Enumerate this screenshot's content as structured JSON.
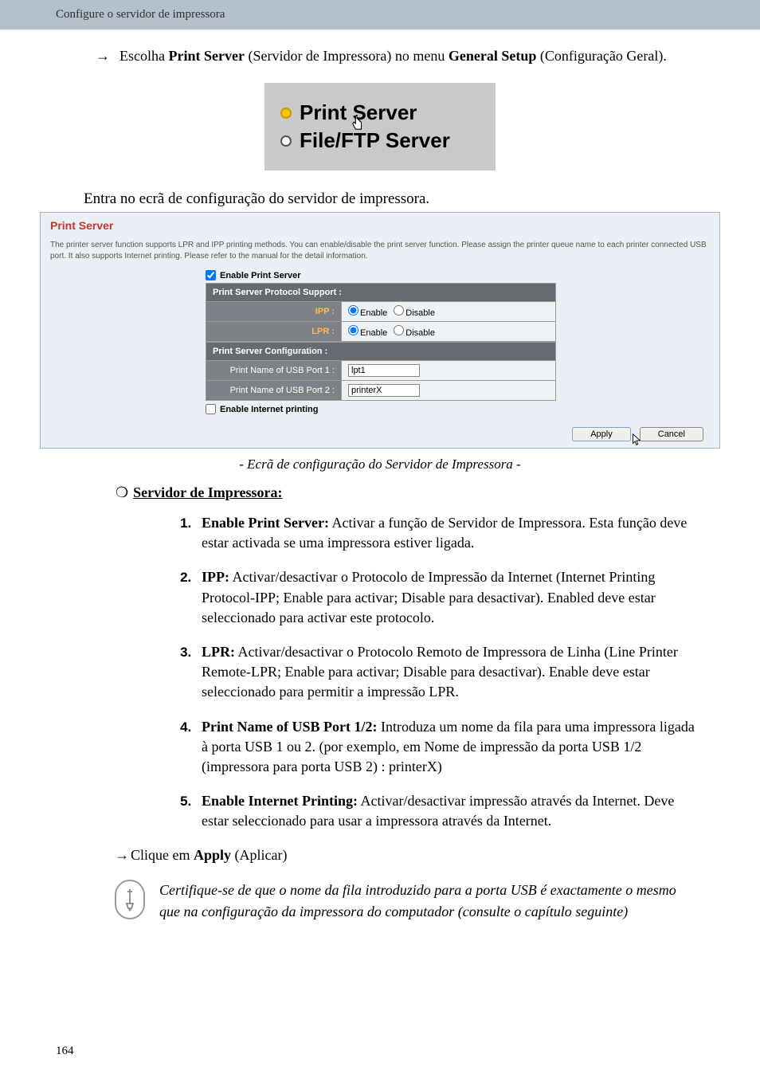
{
  "header": "Configure o servidor de impressora",
  "instruction": {
    "prefix": "Escolha ",
    "b1": "Print Server",
    "mid1": " (Servidor de Impressora) no menu ",
    "b2": "General Setup",
    "suffix": " (Configuração Geral)."
  },
  "menu": {
    "opt1": "Print Server",
    "opt2": "File/FTP Server"
  },
  "lead": "Entra no ecrã de configuração do servidor de impressora.",
  "panel": {
    "title": "Print Server",
    "desc": "The printer server function supports LPR and IPP printing methods. You can enable/disable the print server function. Please assign the printer queue name to each printer connected USB port. It also supports Internet printing. Please refer to the manual for the detail information.",
    "enable_ps": "Enable Print Server",
    "protocol_header": "Print Server Protocol Support :",
    "ipp_label": "IPP :",
    "lpr_label": "LPR :",
    "enable": "Enable",
    "disable": "Disable",
    "config_header": "Print Server Configuration :",
    "usb1_label": "Print Name of USB Port 1 :",
    "usb1_value": "lpt1",
    "usb2_label": "Print Name of USB Port 2 :",
    "usb2_value": "printerX",
    "enable_internet": "Enable Internet printing",
    "apply": "Apply",
    "cancel": "Cancel"
  },
  "caption": "- Ecrã de configuração do Servidor de Impressora -",
  "section_title": "Servidor de Impressora:",
  "items": [
    {
      "label": "Enable Print Server:",
      "body": " Activar a função de Servidor de Impressora. Esta função deve estar activada se uma impressora estiver ligada."
    },
    {
      "label": "IPP:",
      "body": " Activar/desactivar o Protocolo de Impressão da Internet (Internet Printing Protocol-IPP; Enable para activar; Disable para desactivar). Enabled deve estar seleccionado para activar este protocolo."
    },
    {
      "label": "LPR:",
      "body": " Activar/desactivar o Protocolo Remoto de Impressora de Linha (Line Printer Remote-LPR; Enable para activar; Disable para desactivar). Enable deve estar seleccionado para permitir a impressão LPR."
    },
    {
      "label": "Print Name of USB Port 1/2:",
      "body": " Introduza um nome da fila para uma impressora ligada à porta USB 1 ou 2. (por exemplo, em Nome de impressão da porta USB 1/2 (impressora para porta USB 2) : printerX)"
    },
    {
      "label": "Enable Internet Printing:",
      "body": " Activar/desactivar impressão através da Internet. Deve estar seleccionado para usar a impressora através da Internet."
    }
  ],
  "apply_line": {
    "prefix": "Clique em ",
    "b": "Apply",
    "suffix": " (Aplicar)"
  },
  "note": "Certifique-se de que o nome da fila introduzido para a porta USB é exactamente o mesmo que na configuração da impressora do computador (consulte o capítulo seguinte)",
  "page_number": "164"
}
